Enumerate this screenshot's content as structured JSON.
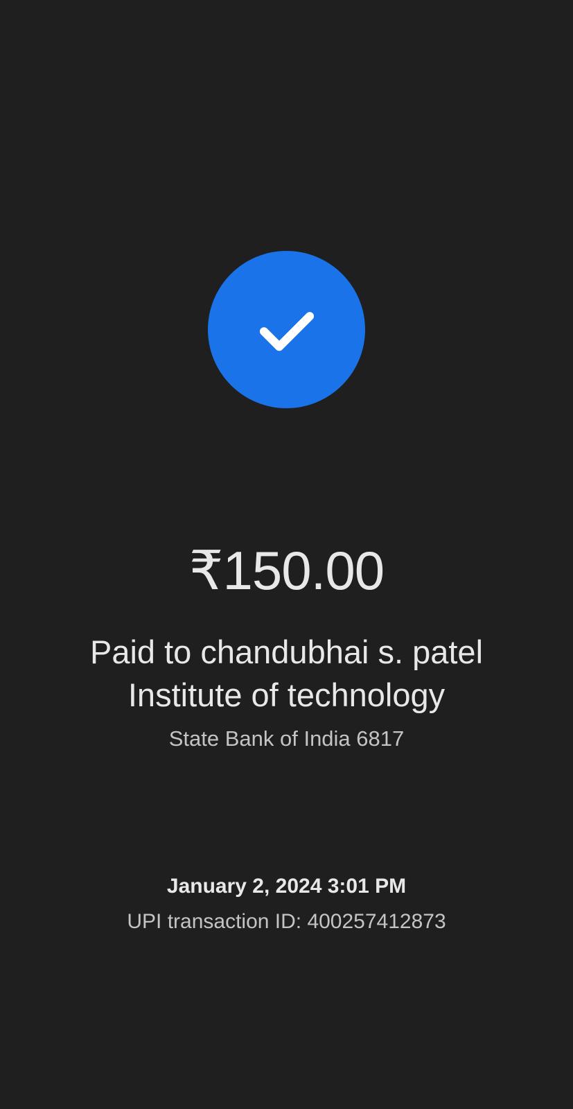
{
  "status": {
    "icon": "check-icon",
    "accent_color": "#1a73e8"
  },
  "payment": {
    "amount": "₹150.00",
    "payee_line1": "Paid to chandubhai s. patel",
    "payee_line2": "Institute of technology",
    "bank": "State Bank of India 6817"
  },
  "transaction": {
    "datetime": "January 2, 2024 3:01 PM",
    "upi_id": "UPI transaction ID: 400257412873"
  }
}
